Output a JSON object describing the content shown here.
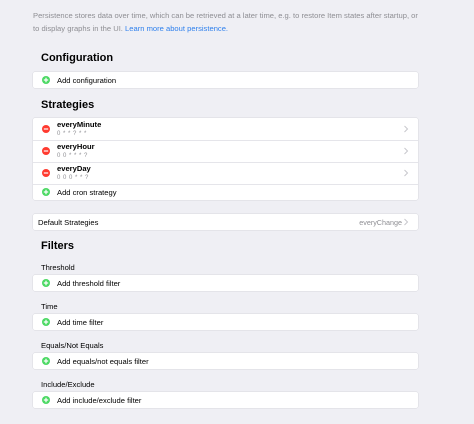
{
  "intro": {
    "text": "Persistence stores data over time, which can be retrieved at a later time, e.g. to restore Item states after startup, or to display graphs in the UI.",
    "link": "Learn more about persistence."
  },
  "configuration": {
    "title": "Configuration",
    "add_label": "Add configuration"
  },
  "strategies": {
    "title": "Strategies",
    "items": [
      {
        "name": "everyMinute",
        "cron": "0 * * ? * *"
      },
      {
        "name": "everyHour",
        "cron": "0 0 * * * ?"
      },
      {
        "name": "everyDay",
        "cron": "0 0 0 * * ?"
      }
    ],
    "add_label": "Add cron strategy"
  },
  "default_strategies": {
    "label": "Default Strategies",
    "value": "everyChange"
  },
  "filters": {
    "title": "Filters",
    "groups": [
      {
        "title": "Threshold",
        "add_label": "Add threshold filter"
      },
      {
        "title": "Time",
        "add_label": "Add time filter"
      },
      {
        "title": "Equals/Not Equals",
        "add_label": "Add equals/not equals filter"
      },
      {
        "title": "Include/Exclude",
        "add_label": "Add include/exclude filter"
      }
    ]
  },
  "colors": {
    "add": "#4cd964",
    "remove": "#ff3b30",
    "link": "#2f80ed",
    "secondary_text": "#8e8e93"
  }
}
